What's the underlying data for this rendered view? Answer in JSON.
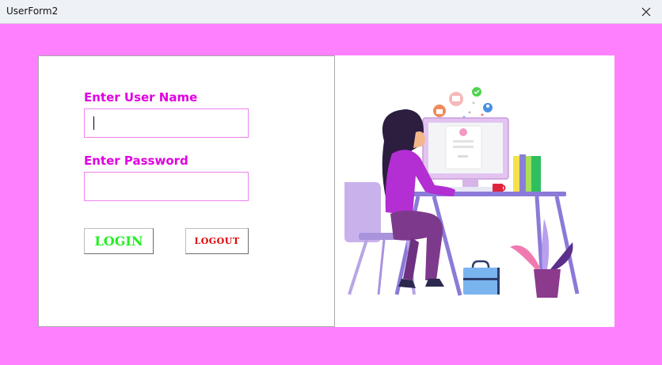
{
  "window": {
    "title": "UserForm2",
    "close_icon": "close-icon"
  },
  "form": {
    "background_color": "#ff80ff",
    "username": {
      "label": "Enter User Name",
      "value": ""
    },
    "password": {
      "label": "Enter Password",
      "value": ""
    },
    "buttons": {
      "login_label": "LOGIN",
      "logout_label": "LOGOUT"
    },
    "colors": {
      "label": "#e000e0",
      "login_text": "#22ee22",
      "logout_text": "#e00000"
    }
  },
  "illustration": {
    "subject": "woman-at-computer-desk-illustration"
  }
}
